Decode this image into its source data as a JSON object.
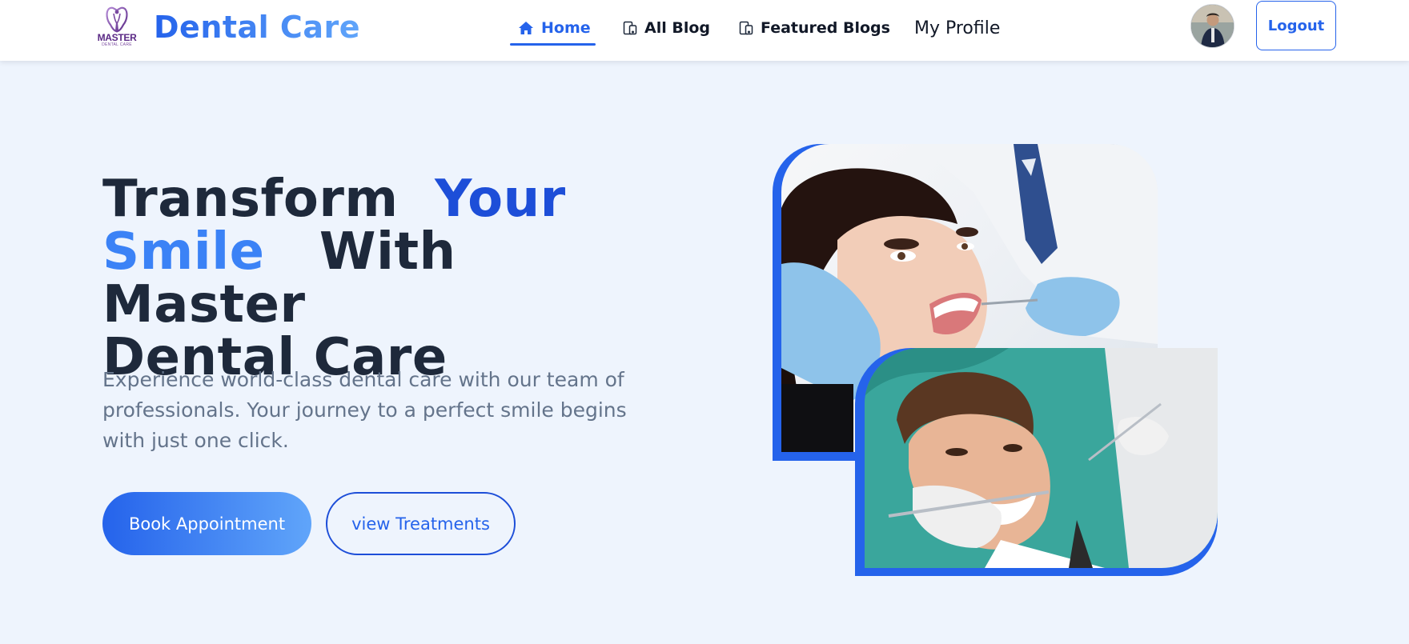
{
  "brand": {
    "logo_text": "MASTER",
    "logo_subtext": "DENTAL CARE",
    "name": "Dental Care"
  },
  "nav": {
    "items": [
      {
        "label": "Home",
        "icon": "home-icon",
        "active": true
      },
      {
        "label": "All Blog",
        "icon": "blog-icon",
        "active": false
      },
      {
        "label": "Featured Blogs",
        "icon": "blog-icon",
        "active": false
      },
      {
        "label": "My Profile",
        "icon": "",
        "active": false
      }
    ],
    "logout_label": "Logout"
  },
  "hero": {
    "title_part1": "Transform",
    "title_highlight1": "Your",
    "title_highlight2": "Smile",
    "title_part2": "With Master",
    "title_part3": "Dental Care",
    "description": "Experience world-class dental care with our team of professionals. Your journey to a perfect smile begins with just one click.",
    "primary_button": "Book Appointment",
    "secondary_button": "view Treatments"
  },
  "colors": {
    "accent": "#2563eb",
    "accent_light": "#60a5fa",
    "background": "#eef4fd",
    "heading": "#1e293b",
    "muted": "#64748b"
  }
}
